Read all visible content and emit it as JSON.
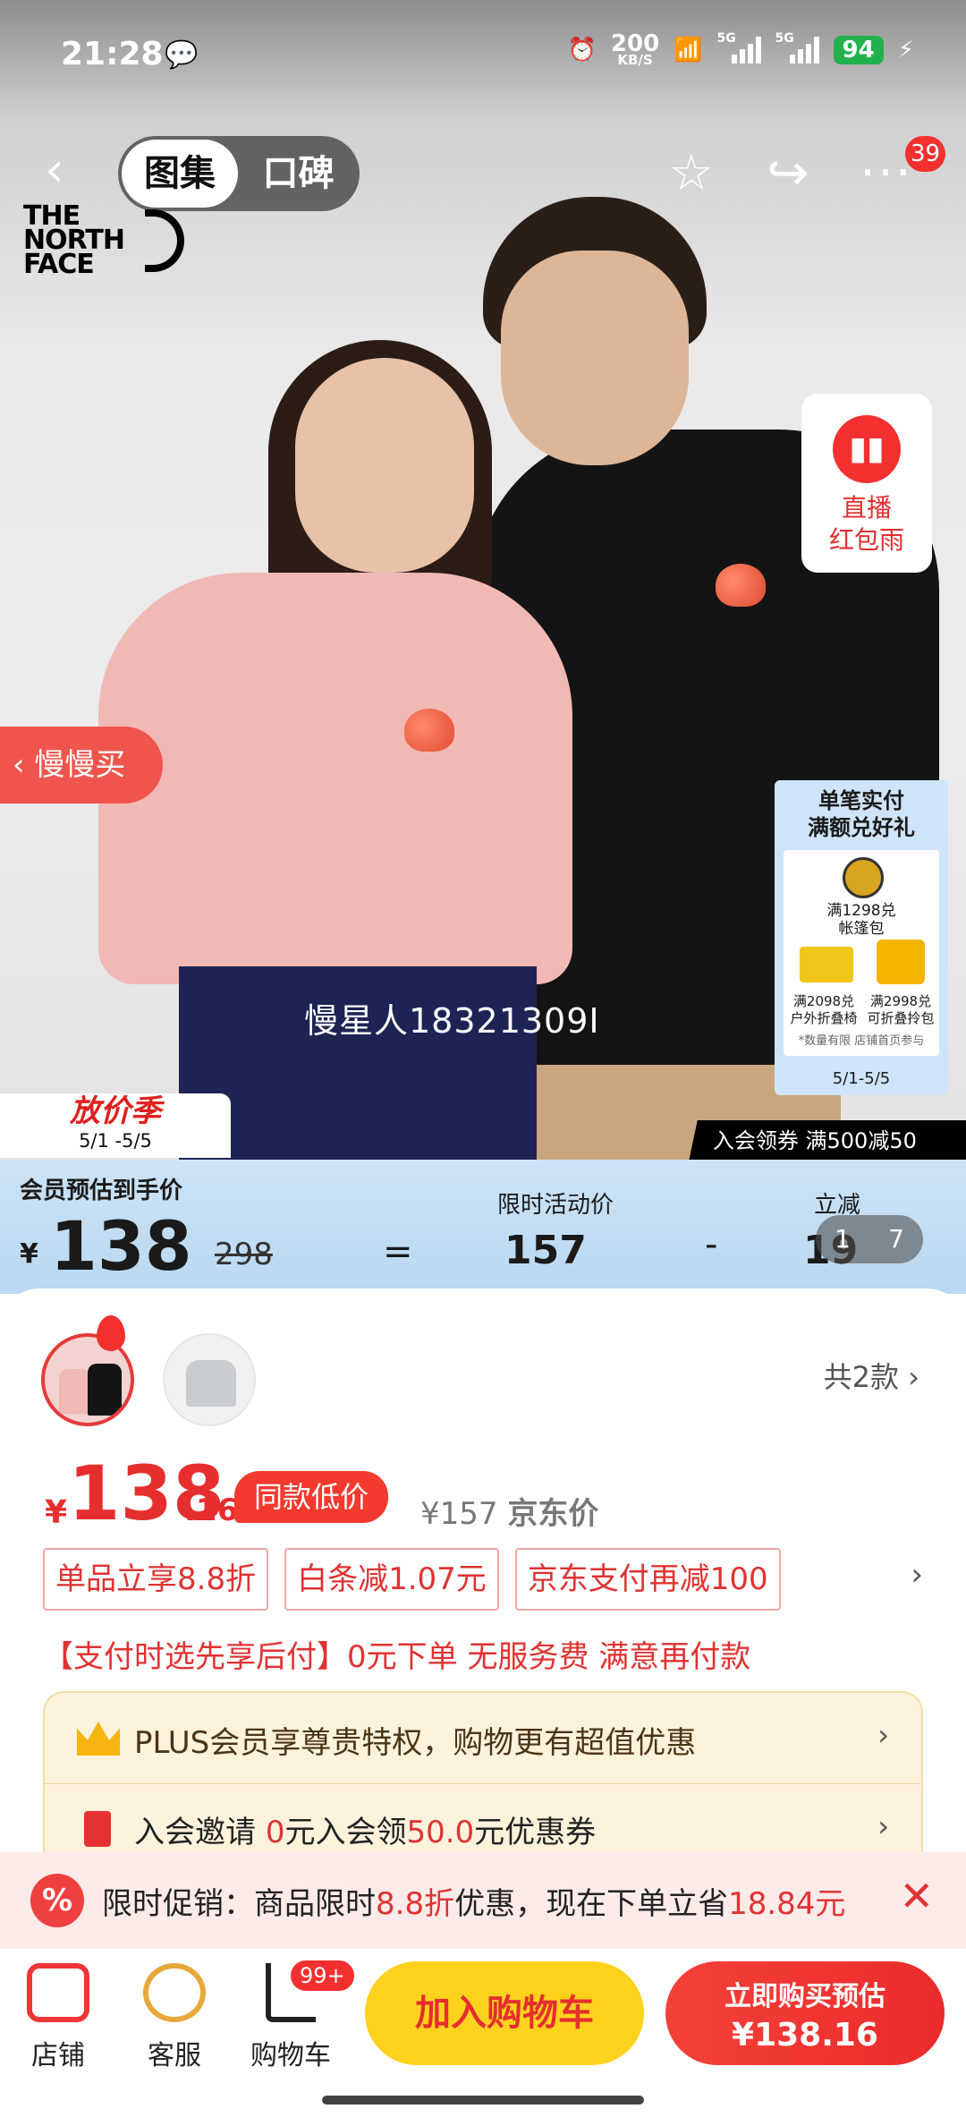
{
  "status_bar": {
    "time": "21:28",
    "net_speed": "200",
    "net_unit": "KB/S",
    "signal1": "5G",
    "signal2": "5G",
    "battery": "94"
  },
  "nav": {
    "tab_gallery": "图集",
    "tab_reviews": "口碑",
    "badge": "39"
  },
  "brand": {
    "line1": "THE",
    "line2": "NORTH",
    "line3": "FACE"
  },
  "live_widget": {
    "line1": "直播",
    "line2": "红包雨"
  },
  "slow_buy_tab": "慢慢买",
  "gift_card": {
    "title1": "单笔实付",
    "title2": "满额兑好礼",
    "item1_a": "满1298兑",
    "item1_b": "帐篷包",
    "item2_a": "满2098兑",
    "item2_b": "户外折叠椅",
    "item3_a": "满2998兑",
    "item3_b": "可折叠拎包",
    "note": "*数量有限 店铺首页参与",
    "date": "5/1-5/5"
  },
  "watermark": "慢星人18321309I",
  "season_tag": {
    "title": "放价季",
    "date": "5/1 -5/5"
  },
  "join_strip": "入会领券 满500减50",
  "member_band": {
    "label": "会员预估到手价",
    "currency": "¥",
    "price": "138",
    "original": "298",
    "equals": "=",
    "activity_label": "限时活动价",
    "activity_value": "157",
    "minus": "-",
    "cut_label": "立减",
    "cut_value": "19"
  },
  "pager": {
    "current": "1",
    "total": "7"
  },
  "sku": {
    "count_text": "共2款"
  },
  "price": {
    "currency": "¥",
    "integer": "138",
    "decimal": ".16",
    "low_tag": "同款低价",
    "jd_value": "¥157",
    "jd_label": "京东价"
  },
  "coupons": [
    "单品立享8.8折",
    "白条减1.07元",
    "京东支付再减100"
  ],
  "pay_later": "【支付时选先享后付】0元下单 无服务费 满意再付款",
  "plus": {
    "text": "PLUS会员享尊贵特权，购物更有超值优惠"
  },
  "join": {
    "pre": "入会邀请 ",
    "amount": "0",
    "mid": "元入会领",
    "coupon": "50.0",
    "post": "元优惠券"
  },
  "promo": {
    "icon": "%",
    "pre": "限时促销：商品限时",
    "discount": "8.8折",
    "mid": "优惠，现在下单立省",
    "saving": "18.84元"
  },
  "bottom_bar": {
    "shop": "店铺",
    "service": "客服",
    "cart": "购物车",
    "cart_badge": "99+",
    "add_cart": "加入购物车",
    "buy_line1": "立即购买预估",
    "buy_line2": "¥138.16"
  },
  "colors": {
    "accent_red": "#e62e2e",
    "cart_yellow": "#ffd21e",
    "member_band": "#cde3f5",
    "plus_bg": "#fdf3dd"
  }
}
